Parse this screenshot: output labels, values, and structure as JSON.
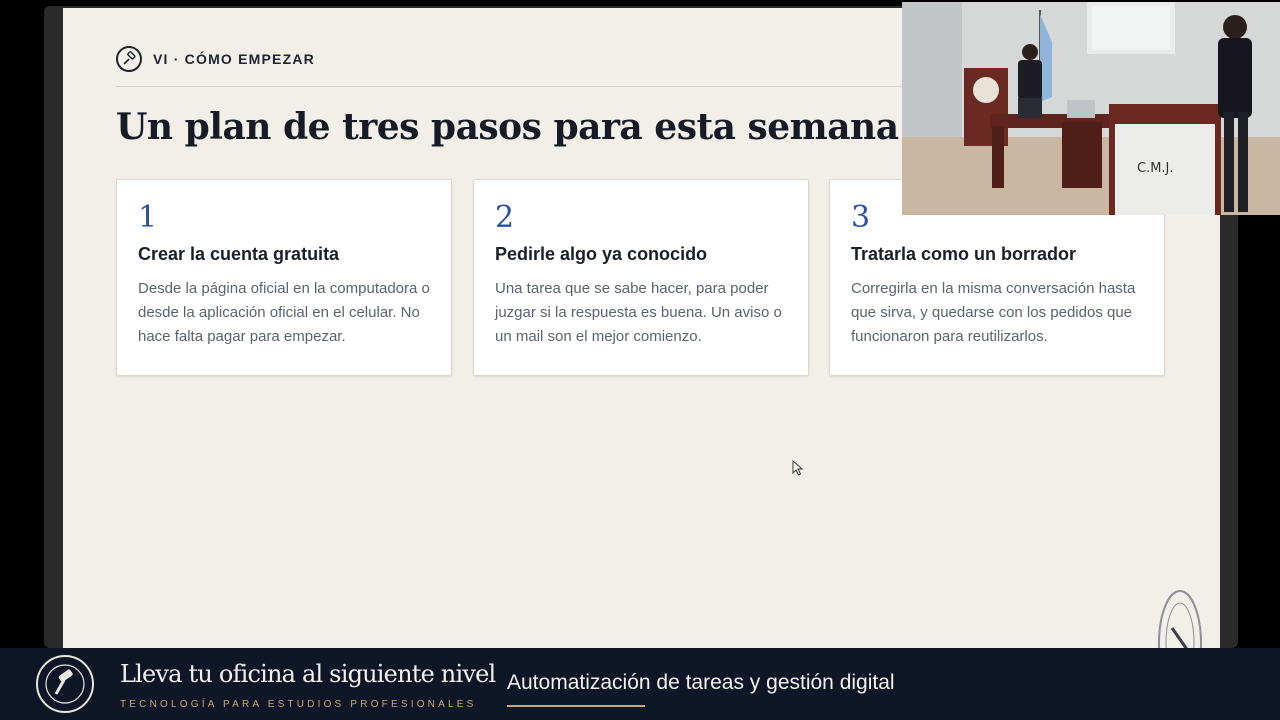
{
  "slide": {
    "section_label": "VI · CÓMO EMPEZAR",
    "title": "Un plan de tres pasos para esta semana",
    "cards": [
      {
        "number": "1",
        "title": "Crear la cuenta gratuita",
        "description": "Desde la página oficial en la computadora o desde la aplicación oficial en el celular. No hace falta pagar para empezar."
      },
      {
        "number": "2",
        "title": "Pedirle algo ya conocido",
        "description": "Una tarea que se sabe hacer, para poder juzgar si la respuesta es buena. Un aviso o un mail son el mejor comienzo."
      },
      {
        "number": "3",
        "title": "Tratarla como un borrador",
        "description": "Corregirla en la misma conversación hasta que sirva, y quedarse con los pedidos que funcionaron para reutilizarlos."
      }
    ]
  },
  "webcam": {
    "podium_text": "C.M.J."
  },
  "bottom_bar": {
    "title": "Lleva tu oficina al siguiente nivel",
    "subtitle": "TECNOLOGÍA PARA ESTUDIOS PROFESIONALES",
    "tagline": "Automatización de tareas y gestión digital"
  },
  "colors": {
    "slide_background": "#f1efe8",
    "accent_number": "#2c4fa3",
    "bar_background": "#0f1628",
    "gold": "#c7a96a"
  },
  "icons": [
    "gavel-icon",
    "cursor-icon",
    "seal-icon",
    "logo-icon"
  ]
}
